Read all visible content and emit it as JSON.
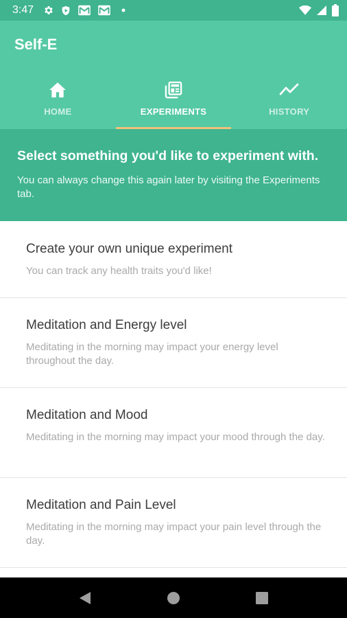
{
  "status_bar": {
    "time": "3:47",
    "left_icons": [
      "gear-icon",
      "shield-play-icon",
      "mail-icon",
      "mail-icon",
      "dot-icon"
    ],
    "right_icons": [
      "wifi-icon",
      "signal-icon",
      "battery-icon"
    ]
  },
  "app": {
    "title": "Self-E",
    "colors": {
      "status_bar": "#3fb48f",
      "app_bar": "#55c9a3",
      "banner": "#3fb48f",
      "tab_indicator": "#f2c27a"
    }
  },
  "tabs": [
    {
      "label": "HOME",
      "icon": "home-icon",
      "active": false
    },
    {
      "label": "EXPERIMENTS",
      "icon": "newspaper-icon",
      "active": true
    },
    {
      "label": "HISTORY",
      "icon": "trending-line-icon",
      "active": false
    }
  ],
  "banner": {
    "title": "Select something you'd like to experiment with.",
    "subtitle": "You can always change this again later by visiting the Experiments tab."
  },
  "experiments": [
    {
      "title": "Create your own unique experiment",
      "description": "You can track any health traits you'd like!"
    },
    {
      "title": "Meditation and Energy level",
      "description": "Meditating in the morning may impact your energy level throughout the day."
    },
    {
      "title": "Meditation and Mood",
      "description": "Meditating in the morning may impact your mood through the day."
    },
    {
      "title": "Meditation and Pain Level",
      "description": "Meditating in the morning may impact your pain level through the day."
    }
  ],
  "nav_bar": {
    "buttons": [
      "back-icon",
      "home-circle-icon",
      "recents-square-icon"
    ]
  }
}
